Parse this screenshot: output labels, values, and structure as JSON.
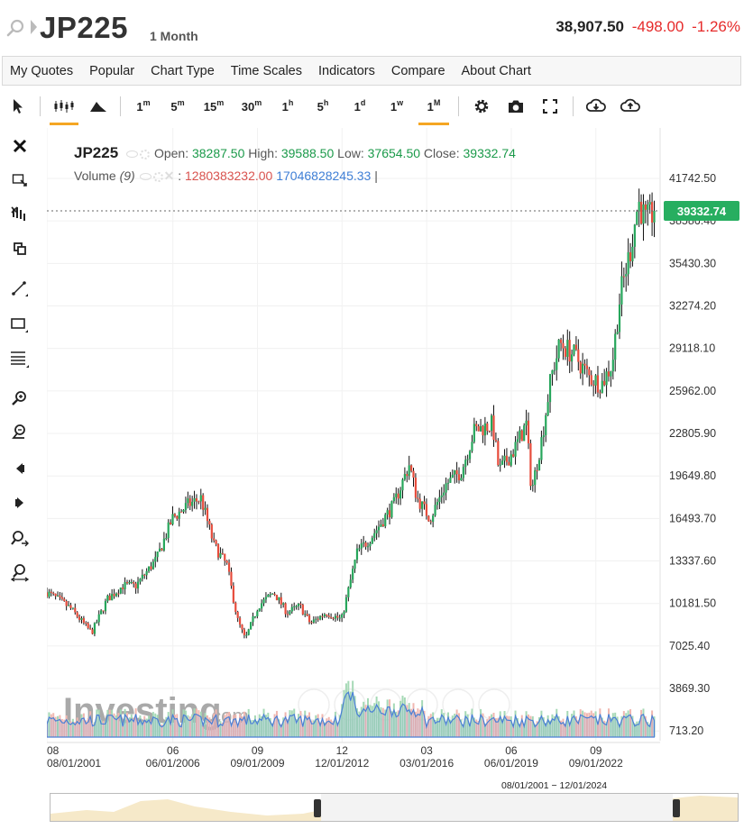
{
  "header": {
    "symbol": "JP225",
    "period": "1 Month",
    "last": "38,907.50",
    "change": "-498.00",
    "change_pct": "-1.26%"
  },
  "menu": [
    "My Quotes",
    "Popular",
    "Chart Type",
    "Time Scales",
    "Indicators",
    "Compare",
    "About Chart"
  ],
  "toolbar": {
    "timescales": [
      {
        "base": "1",
        "sup": "m"
      },
      {
        "base": "5",
        "sup": "m"
      },
      {
        "base": "15",
        "sup": "m"
      },
      {
        "base": "30",
        "sup": "m"
      },
      {
        "base": "1",
        "sup": "h"
      },
      {
        "base": "5",
        "sup": "h"
      },
      {
        "base": "1",
        "sup": "d"
      },
      {
        "base": "1",
        "sup": "w"
      },
      {
        "base": "1",
        "sup": "M"
      }
    ],
    "active_timescale": "1M"
  },
  "legend": {
    "symbol": "JP225",
    "open_label": "Open:",
    "open": "38287.50",
    "high_label": "High:",
    "high": "39588.50",
    "low_label": "Low:",
    "low": "37654.50",
    "close_label": "Close:",
    "close": "39332.74",
    "volume_label": "Volume",
    "volume_param": "(9)",
    "volume_val1": "1280383232.00",
    "volume_val2": "17046828245.33"
  },
  "watermark": {
    "brand": "Investing",
    "suffix": ".com"
  },
  "range_label": "08/01/2001 − 12/01/2024",
  "colors": {
    "up": "#26a65b",
    "down": "#e74c3c",
    "accent": "#f5a623",
    "price_tag": "#27ae60",
    "volume": "#4a7fd6"
  },
  "chart_data": {
    "type": "candlestick",
    "last_price": 39332.74,
    "y_ticks": [
      "41742.50",
      "38586.40",
      "35430.30",
      "32274.20",
      "29118.10",
      "25962.00",
      "22805.90",
      "19649.80",
      "16493.70",
      "13337.60",
      "10181.50",
      "7025.40",
      "3869.30",
      "713.20"
    ],
    "x_ticks": [
      {
        "top": "08",
        "bottom": "08/01/2001"
      },
      {
        "top": "06",
        "bottom": "06/01/2006"
      },
      {
        "top": "09",
        "bottom": "09/01/2009"
      },
      {
        "top": "12",
        "bottom": "12/01/2012"
      },
      {
        "top": "03",
        "bottom": "03/01/2016"
      },
      {
        "top": "06",
        "bottom": "06/01/2019"
      },
      {
        "top": "09",
        "bottom": "09/01/2022"
      }
    ],
    "close_path": [
      [
        2001.58,
        11000
      ],
      [
        2002.0,
        10500
      ],
      [
        2002.5,
        9800
      ],
      [
        2003.3,
        8000
      ],
      [
        2003.9,
        10500
      ],
      [
        2004.5,
        11500
      ],
      [
        2005.0,
        11500
      ],
      [
        2005.8,
        13500
      ],
      [
        2006.4,
        16500
      ],
      [
        2007.0,
        17500
      ],
      [
        2007.5,
        18000
      ],
      [
        2008.0,
        14500
      ],
      [
        2008.5,
        13000
      ],
      [
        2008.9,
        9000
      ],
      [
        2009.2,
        7500
      ],
      [
        2009.7,
        10000
      ],
      [
        2010.3,
        11000
      ],
      [
        2010.8,
        9500
      ],
      [
        2011.3,
        10000
      ],
      [
        2011.7,
        8700
      ],
      [
        2012.3,
        9500
      ],
      [
        2012.9,
        9000
      ],
      [
        2013.5,
        14000
      ],
      [
        2014.0,
        15000
      ],
      [
        2014.9,
        17500
      ],
      [
        2015.5,
        20500
      ],
      [
        2015.8,
        18000
      ],
      [
        2016.3,
        16500
      ],
      [
        2016.9,
        19000
      ],
      [
        2017.5,
        20000
      ],
      [
        2018.0,
        23000
      ],
      [
        2018.7,
        23500
      ],
      [
        2018.95,
        20000
      ],
      [
        2019.5,
        21500
      ],
      [
        2020.0,
        23500
      ],
      [
        2020.2,
        18500
      ],
      [
        2020.6,
        22500
      ],
      [
        2020.95,
        27000
      ],
      [
        2021.3,
        29500
      ],
      [
        2021.9,
        28500
      ],
      [
        2022.4,
        27000
      ],
      [
        2022.9,
        26500
      ],
      [
        2023.3,
        28000
      ],
      [
        2023.6,
        33000
      ],
      [
        2024.0,
        36500
      ],
      [
        2024.3,
        40000
      ],
      [
        2024.6,
        38500
      ],
      [
        2024.92,
        39332.74
      ]
    ],
    "volume_note": "Volume histogram with moving-average area",
    "ylim": [
      713.2,
      43000
    ],
    "xlim": [
      2001.58,
      2025.0
    ]
  }
}
